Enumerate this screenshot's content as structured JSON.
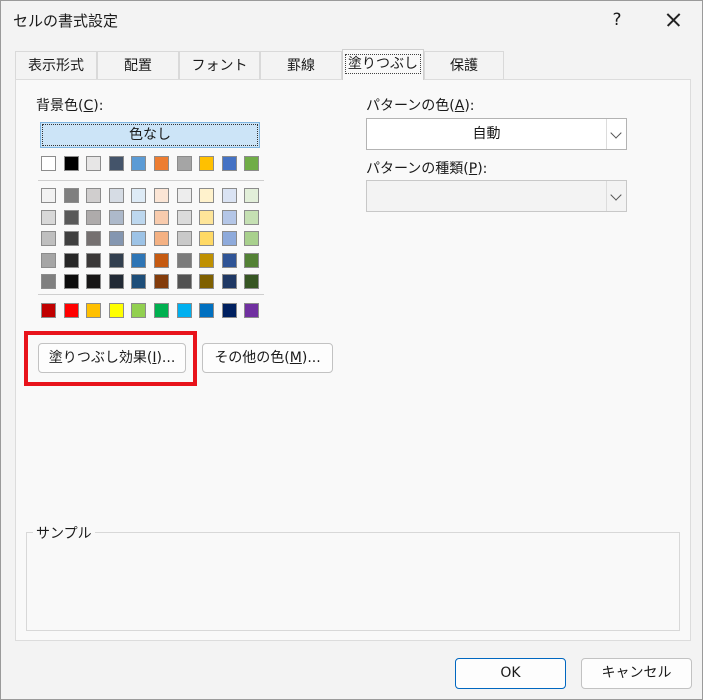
{
  "window": {
    "title": "セルの書式設定",
    "help_label": "?"
  },
  "tabs": [
    {
      "label": "表示形式"
    },
    {
      "label": "配置"
    },
    {
      "label": "フォント"
    },
    {
      "label": "罫線"
    },
    {
      "label": "塗りつぶし",
      "active": true
    },
    {
      "label": "保護"
    }
  ],
  "background_color": {
    "label_prefix": "背景色(",
    "label_key": "C",
    "label_suffix": "):",
    "no_color_label": "色なし",
    "theme_row": [
      "#ffffff",
      "#000000",
      "#e7e6e6",
      "#44546a",
      "#5b9bd5",
      "#ed7d31",
      "#a5a5a5",
      "#ffc000",
      "#4472c4",
      "#70ad47"
    ],
    "tint_rows": [
      [
        "#f2f2f2",
        "#7f7f7f",
        "#d0cece",
        "#d6dce4",
        "#deebf6",
        "#fbe5d5",
        "#ededed",
        "#fff2cc",
        "#dae3f3",
        "#e2efd9"
      ],
      [
        "#d8d8d8",
        "#595959",
        "#aeabab",
        "#adb9ca",
        "#bdd7ee",
        "#f8cbad",
        "#dbdbdb",
        "#fee599",
        "#b4c6e7",
        "#c5e0b3"
      ],
      [
        "#bfbfbf",
        "#3f3f3f",
        "#757070",
        "#8496b0",
        "#9dc3e6",
        "#f4b183",
        "#c9c9c9",
        "#ffd965",
        "#8eaadb",
        "#a8d08d"
      ],
      [
        "#a5a5a5",
        "#262626",
        "#3a3838",
        "#323f4f",
        "#2e75b5",
        "#c55a11",
        "#7b7b7b",
        "#bf9000",
        "#2f5496",
        "#538135"
      ],
      [
        "#7f7f7f",
        "#0c0c0c",
        "#171616",
        "#222a35",
        "#1e4e79",
        "#833c0b",
        "#525252",
        "#7f6000",
        "#1f3864",
        "#375623"
      ]
    ],
    "standard_row": [
      "#c00000",
      "#ff0000",
      "#ffc000",
      "#ffff00",
      "#92d050",
      "#00b050",
      "#00b0f0",
      "#0070c0",
      "#002060",
      "#7030a0"
    ]
  },
  "buttons": {
    "fill_effects": {
      "prefix": "塗りつぶし効果(",
      "key": "I",
      "suffix": ")..."
    },
    "more_colors": {
      "prefix": "その他の色(",
      "key": "M",
      "suffix": ")..."
    }
  },
  "pattern_color": {
    "label_prefix": "パターンの色(",
    "label_key": "A",
    "label_suffix": "):",
    "value": "自動"
  },
  "pattern_style": {
    "label_prefix": "パターンの種類(",
    "label_key": "P",
    "label_suffix": "):",
    "value": ""
  },
  "sample": {
    "label": "サンプル"
  },
  "footer": {
    "ok_label": "OK",
    "cancel_label": "キャンセル"
  }
}
